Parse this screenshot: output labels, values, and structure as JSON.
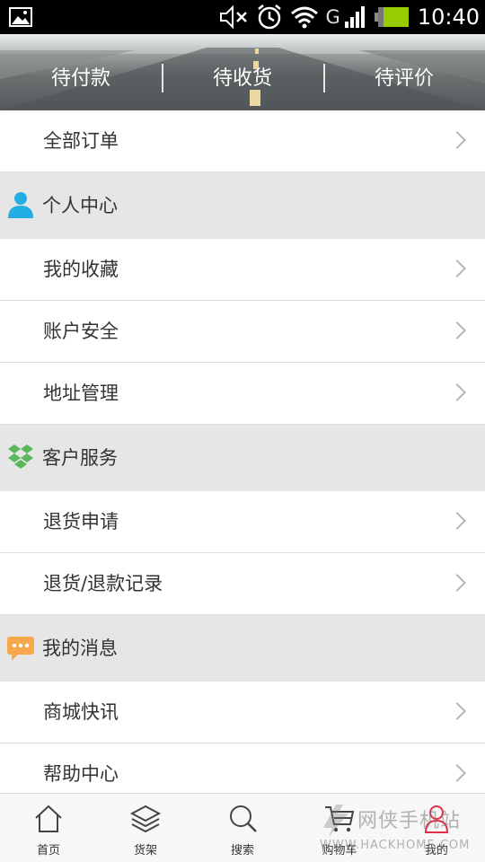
{
  "status_bar": {
    "time": "10:40",
    "network": "G",
    "icons": [
      "image-icon",
      "mute-icon",
      "alarm-icon",
      "wifi-icon",
      "signal-icon",
      "battery-icon"
    ]
  },
  "header": {
    "tabs": [
      {
        "label": "待付款"
      },
      {
        "label": "待收货"
      },
      {
        "label": "待评价"
      }
    ]
  },
  "list": {
    "all_orders": "全部订单",
    "personal_center": {
      "title": "个人中心",
      "icon": "person-icon",
      "items": [
        "我的收藏",
        "账户安全",
        "地址管理"
      ]
    },
    "customer_service": {
      "title": "客户服务",
      "icon": "dropbox-icon",
      "items": [
        "退货申请",
        "退货/退款记录"
      ]
    },
    "messages": {
      "title": "我的消息",
      "icon": "chat-icon",
      "items": [
        "商城快讯",
        "帮助中心"
      ]
    }
  },
  "bottom_nav": {
    "items": [
      {
        "label": "首页",
        "icon": "home-icon"
      },
      {
        "label": "货架",
        "icon": "layers-icon"
      },
      {
        "label": "搜索",
        "icon": "search-icon"
      },
      {
        "label": "购物车",
        "icon": "cart-icon"
      },
      {
        "label": "我的",
        "icon": "user-icon"
      }
    ]
  },
  "watermark": {
    "cn": "网侠手机站",
    "en": "WWW.HACKHOME.COM"
  },
  "colors": {
    "section_bg": "#e6e6e6",
    "person_icon": "#21aee3",
    "dropbox_icon": "#5cb85c",
    "chat_icon": "#f7a84a",
    "battery": "#99cc00"
  }
}
